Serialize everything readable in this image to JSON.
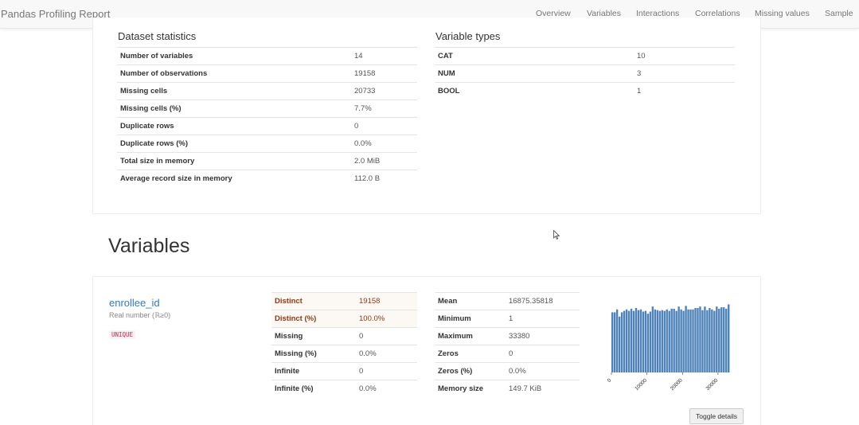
{
  "navbar": {
    "brand": "Pandas Profiling Report",
    "items": [
      "Overview",
      "Variables",
      "Interactions",
      "Correlations",
      "Missing values",
      "Sample"
    ]
  },
  "overview": {
    "dataset_statistics": {
      "title": "Dataset statistics",
      "rows": [
        {
          "label": "Number of variables",
          "value": "14"
        },
        {
          "label": "Number of observations",
          "value": "19158"
        },
        {
          "label": "Missing cells",
          "value": "20733"
        },
        {
          "label": "Missing cells (%)",
          "value": "7.7%"
        },
        {
          "label": "Duplicate rows",
          "value": "0"
        },
        {
          "label": "Duplicate rows (%)",
          "value": "0.0%"
        },
        {
          "label": "Total size in memory",
          "value": "2.0 MiB"
        },
        {
          "label": "Average record size in memory",
          "value": "112.0 B"
        }
      ]
    },
    "variable_types": {
      "title": "Variable types",
      "rows": [
        {
          "label": "CAT",
          "value": "10"
        },
        {
          "label": "NUM",
          "value": "3"
        },
        {
          "label": "BOOL",
          "value": "1"
        }
      ]
    }
  },
  "variables": {
    "title": "Variables",
    "variable": {
      "name": "enrollee_id",
      "type": "Real number (ℝ≥0)",
      "badge": "UNIQUE",
      "stats_left": [
        {
          "label": "Distinct",
          "value": "19158",
          "alert": true
        },
        {
          "label": "Distinct (%)",
          "value": "100.0%",
          "alert": true
        },
        {
          "label": "Missing",
          "value": "0",
          "alert": false
        },
        {
          "label": "Missing (%)",
          "value": "0.0%",
          "alert": false
        },
        {
          "label": "Infinite",
          "value": "0",
          "alert": false
        },
        {
          "label": "Infinite (%)",
          "value": "0.0%",
          "alert": false
        }
      ],
      "stats_right": [
        {
          "label": "Mean",
          "value": "16875.35818"
        },
        {
          "label": "Minimum",
          "value": "1"
        },
        {
          "label": "Maximum",
          "value": "33380"
        },
        {
          "label": "Zeros",
          "value": "0"
        },
        {
          "label": "Zeros (%)",
          "value": "0.0%"
        },
        {
          "label": "Memory size",
          "value": "149.7 KiB"
        }
      ],
      "toggle_label": "Toggle details"
    }
  },
  "chart_data": {
    "type": "bar",
    "x_tick_labels": [
      "0",
      "10000",
      "20000",
      "30000"
    ],
    "x_ticks": [
      0,
      10000,
      20000,
      30000
    ],
    "xlim": [
      1,
      33380
    ],
    "bar_color": "#4c82b8",
    "values": [
      0.84,
      0.84,
      0.88,
      0.78,
      0.84,
      0.86,
      0.88,
      0.86,
      0.89,
      0.86,
      0.9,
      0.87,
      0.88,
      0.85,
      0.86,
      0.82,
      0.85,
      0.92,
      0.88,
      0.87,
      0.86,
      0.87,
      0.86,
      0.88,
      0.86,
      0.89,
      0.89,
      0.86,
      0.92,
      0.88,
      0.86,
      0.93,
      0.88,
      0.88,
      0.88,
      0.9,
      0.9,
      0.92,
      0.87,
      0.92,
      0.87,
      0.9,
      0.88,
      0.86,
      0.92,
      0.89,
      0.91,
      0.91,
      0.89,
      0.95
    ]
  }
}
